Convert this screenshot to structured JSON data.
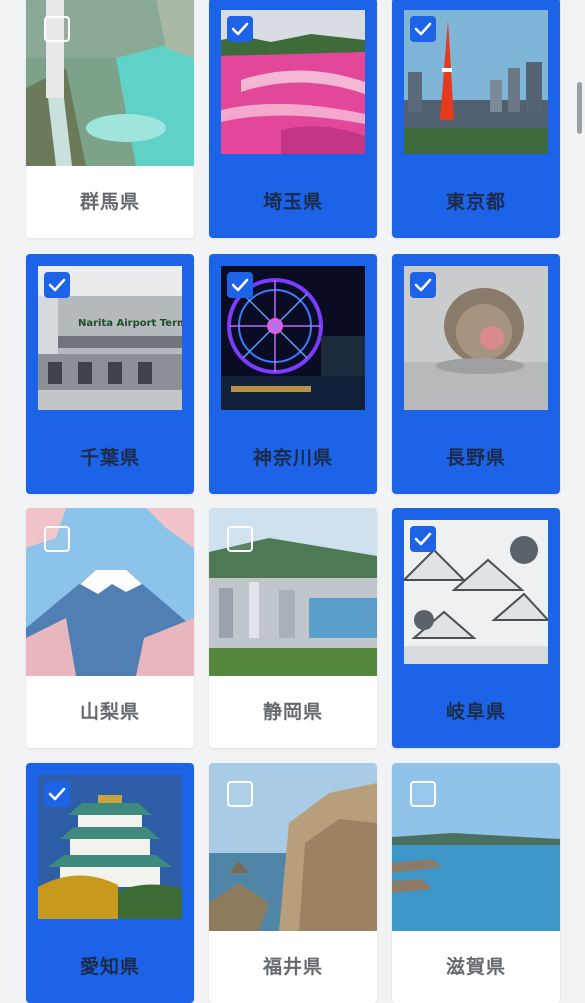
{
  "prefectures": [
    {
      "name": "群馬県",
      "selected": false
    },
    {
      "name": "埼玉県",
      "selected": true
    },
    {
      "name": "東京都",
      "selected": true
    },
    {
      "name": "千葉県",
      "selected": true
    },
    {
      "name": "神奈川県",
      "selected": true
    },
    {
      "name": "長野県",
      "selected": true
    },
    {
      "name": "山梨県",
      "selected": false
    },
    {
      "name": "静岡県",
      "selected": false
    },
    {
      "name": "岐阜県",
      "selected": true
    },
    {
      "name": "愛知県",
      "selected": true
    },
    {
      "name": "福井県",
      "selected": false
    },
    {
      "name": "滋賀県",
      "selected": false
    }
  ],
  "photos": {
    "chiba_sign": "Narita Airport Terminal"
  },
  "colors": {
    "selected_bg": "#1d63e8",
    "label_selected": "#1b2b4a",
    "label_default": "#666a70"
  }
}
